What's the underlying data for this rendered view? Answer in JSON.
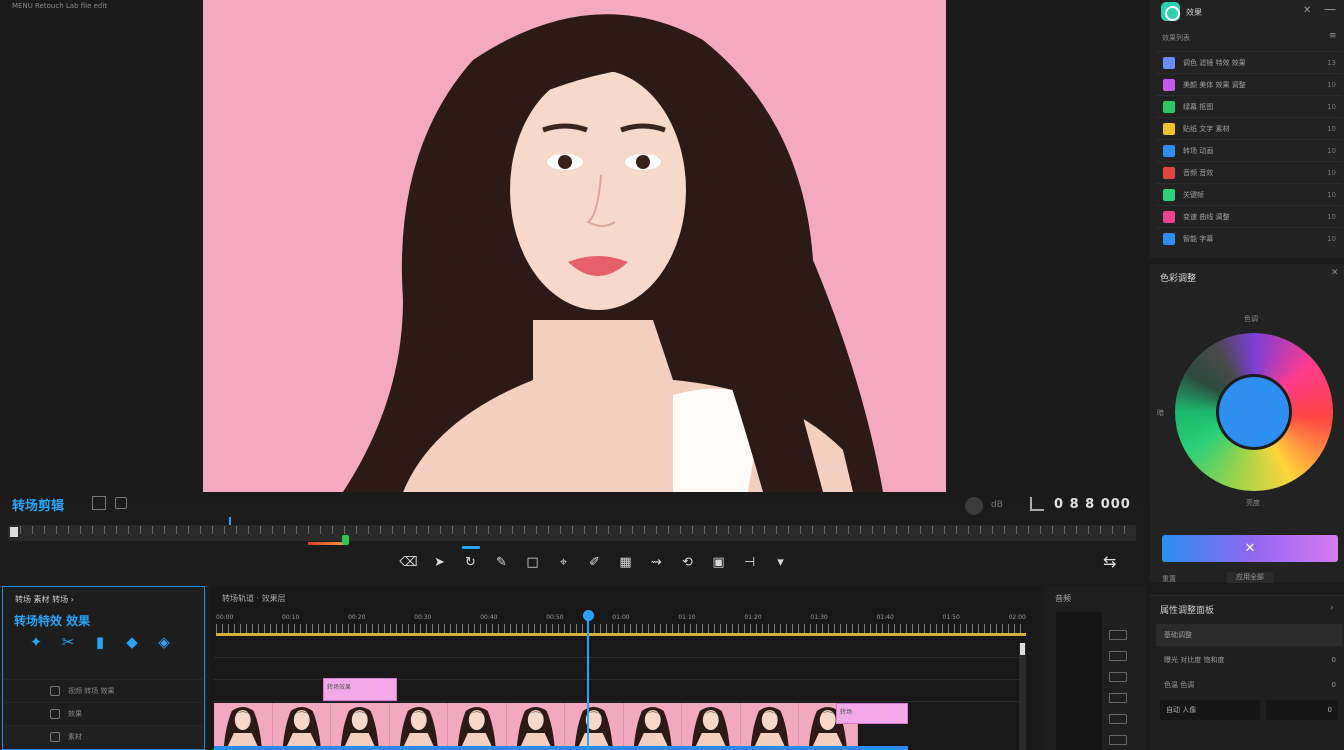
{
  "app": {
    "title": "MENU  Retouch Lab  file  edit"
  },
  "editor": {
    "title": "转场剪辑",
    "timecode": "0 8 8 000",
    "volume_text": "dB"
  },
  "toolbar": {
    "tools": [
      {
        "name": "eraser-tool",
        "glyph": "⌫"
      },
      {
        "name": "select-tool",
        "glyph": "➤"
      },
      {
        "name": "rotate-tool",
        "glyph": "↻",
        "active": true
      },
      {
        "name": "pen-tool",
        "glyph": "✎"
      },
      {
        "name": "crop-tool",
        "glyph": "□"
      },
      {
        "name": "brush-tool",
        "glyph": "⌖"
      },
      {
        "name": "marker-tool",
        "glyph": "✐"
      },
      {
        "name": "film-tool",
        "glyph": "▦"
      },
      {
        "name": "speed-tool",
        "glyph": "⇝"
      },
      {
        "name": "loop-tool",
        "glyph": "⟲"
      },
      {
        "name": "image-tool",
        "glyph": "▣"
      },
      {
        "name": "split-tool",
        "glyph": "⊣"
      },
      {
        "name": "marker-flag-tool",
        "glyph": "▾"
      }
    ],
    "right_glyph": "⇆"
  },
  "effects_panel": {
    "title": "效果",
    "subtitle": "效果列表",
    "rows": [
      {
        "label": "调色 滤镜 特效 效果",
        "value": "13",
        "color": "#6a8cff"
      },
      {
        "label": "美颜 美体 效果 调整",
        "value": "10",
        "color": "#c45af0"
      },
      {
        "label": "绿幕 抠图",
        "value": "10",
        "color": "#2fc46a"
      },
      {
        "label": "贴纸 文字 素材",
        "value": "10",
        "color": "#f5c12a"
      },
      {
        "label": "转场 动画",
        "value": "10",
        "color": "#2e8ff0"
      },
      {
        "label": "音频 音效",
        "value": "10",
        "color": "#e2453c"
      },
      {
        "label": "关键帧",
        "value": "10",
        "color": "#2fd07a"
      },
      {
        "label": "变速 曲线 调整",
        "value": "10",
        "color": "#f0418c"
      },
      {
        "label": "智能 字幕",
        "value": "10",
        "color": "#2e8ff0"
      }
    ]
  },
  "color_wheel": {
    "title": "色彩调整",
    "label_top": "色调",
    "label_left": "暗",
    "label_bottom": "亮度",
    "apply_label": "✕",
    "note_left": "重置",
    "note_right": "应用全部"
  },
  "properties": {
    "title": "属性调整面板",
    "rows": [
      {
        "label": "基础调整",
        "value": ""
      },
      {
        "label": "曝光 对比度 饱和度",
        "value": "0"
      },
      {
        "label": "色温 色调",
        "value": "0"
      }
    ],
    "field_left": "自动 人像",
    "field_right": "0"
  },
  "tools_panel": {
    "title": "转场 素材 转场 ›",
    "heading": "转场特效 效果",
    "icons": [
      {
        "name": "fx-icon-1",
        "glyph": "✦"
      },
      {
        "name": "fx-icon-2",
        "glyph": "✂"
      },
      {
        "name": "fx-icon-3",
        "glyph": "▮"
      },
      {
        "name": "fx-icon-4",
        "glyph": "◆"
      },
      {
        "name": "fx-icon-5",
        "glyph": "◈"
      }
    ],
    "rows": [
      {
        "label": "视频 转场 效果"
      },
      {
        "label": "效果"
      },
      {
        "label": "素材"
      }
    ]
  },
  "timeline": {
    "label": "转场轨道 · 效果层",
    "ruler": [
      "00:00",
      "00:10",
      "00:20",
      "00:30",
      "00:40",
      "00:50",
      "01:00",
      "01:10",
      "01:20",
      "01:30",
      "01:40",
      "01:50",
      "02:00"
    ],
    "clip_pink1": "转场效果",
    "clip_pink2": "转场",
    "frames": 11
  },
  "audio_meter": {
    "label": "音频"
  }
}
